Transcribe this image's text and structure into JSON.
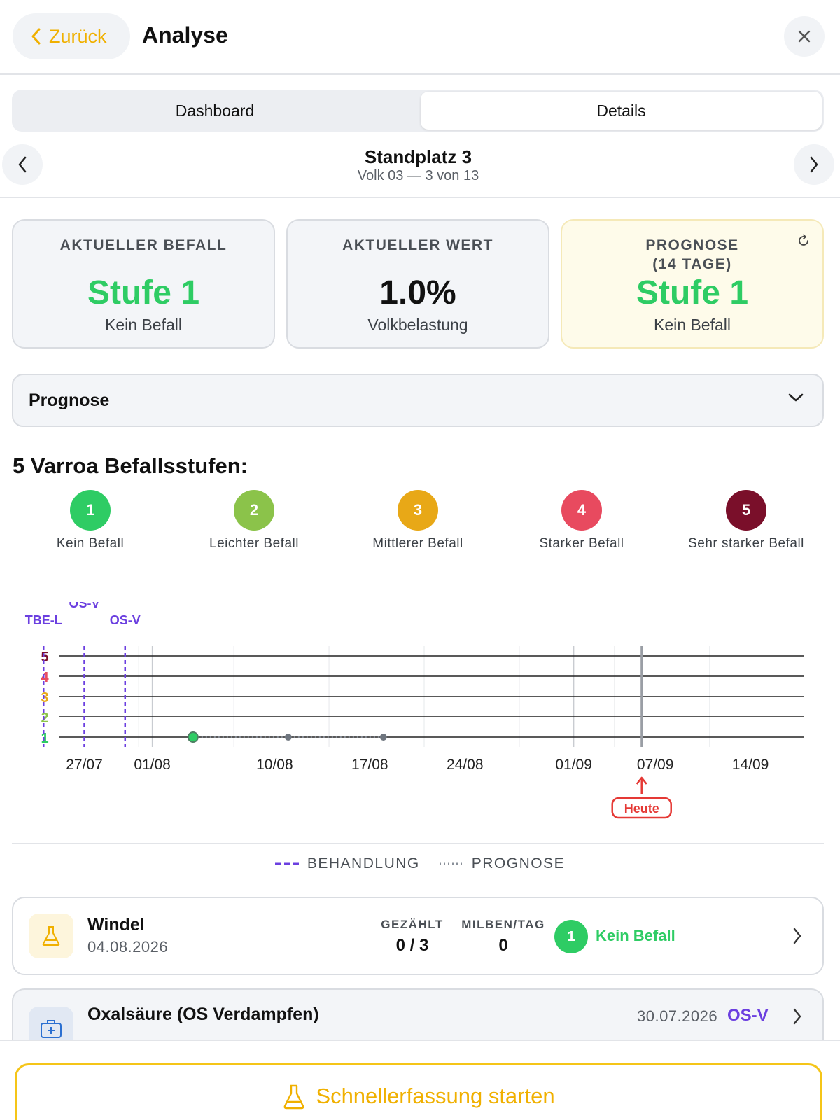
{
  "header": {
    "back_label": "Zurück",
    "title": "Analyse",
    "close_icon": "close-icon",
    "accent_color": "#f0b000"
  },
  "tabs": [
    {
      "label": "Dashboard",
      "selected": false
    },
    {
      "label": "Details",
      "selected": true
    }
  ],
  "location": {
    "title": "Standplatz 3",
    "subtitle": "Volk 03 — 3 von 13"
  },
  "cards": [
    {
      "label": "AKTUELLER BEFALL",
      "value": "Stufe 1",
      "sub": "Kein Befall"
    },
    {
      "label": "AKTUELLER WERT",
      "value": "1.0%",
      "sub": "Volkbelastung"
    },
    {
      "label_line1": "PROGNOSE",
      "label_line2": "(14 TAGE)",
      "value": "Stufe 1",
      "sub": "Kein Befall"
    }
  ],
  "prognose_dropdown": {
    "label": "Prognose"
  },
  "levels": {
    "title": "5 Varroa Befallsstufen:",
    "items": [
      {
        "number": "1",
        "label": "Kein Befall",
        "color": "#2ecc64"
      },
      {
        "number": "2",
        "label": "Leichter Befall",
        "color": "#8bc34a"
      },
      {
        "number": "3",
        "label": "Mittlerer Befall",
        "color": "#e8a817"
      },
      {
        "number": "4",
        "label": "Starker Befall",
        "color": "#e84a5f"
      },
      {
        "number": "5",
        "label": "Sehr starker Befall",
        "color": "#7a0f2a"
      }
    ]
  },
  "chart_data": {
    "type": "line",
    "x_ticks": [
      "27/07",
      "01/08",
      "10/08",
      "17/08",
      "24/08",
      "01/09",
      "07/09",
      "14/09"
    ],
    "y_ticks": [
      "1",
      "2",
      "3",
      "4",
      "5"
    ],
    "y_tick_colors": [
      "#2ecc64",
      "#8bc34a",
      "#e8a817",
      "#e84a5f",
      "#7a0f2a"
    ],
    "ylim": [
      1,
      5
    ],
    "treatments": [
      {
        "label": "TBE-L",
        "date": "24/07"
      },
      {
        "label": "OS-V",
        "date": "27/07"
      },
      {
        "label": "OS-V",
        "date": "30/07"
      }
    ],
    "treatment_color": "#6b3fe0",
    "series": [
      {
        "x": [
          "04/08"
        ],
        "y": [
          1
        ]
      }
    ],
    "forecast": [
      {
        "x": [
          "04/08",
          "11/08",
          "18/08"
        ],
        "y": [
          1,
          1,
          1
        ]
      }
    ],
    "today": {
      "date": "06/09",
      "label": "Heute",
      "color": "#e53935"
    }
  },
  "legend": {
    "treatment": "BEHANDLUNG",
    "forecast": "PROGNOSE"
  },
  "entries": [
    {
      "title": "Windel",
      "date": "04.08.2026",
      "counted_label": "GEZÄHLT",
      "counted_value": "0 / 3",
      "mites_label": "MILBEN/TAG",
      "mites_value": "0",
      "level": "1",
      "level_label": "Kein Befall",
      "icon": "flask-icon"
    },
    {
      "title": "Oxalsäure (OS Verdampfen)",
      "date": "30.07.2026",
      "tag": "OS-V",
      "icon": "medkit-icon"
    }
  ],
  "quick_action": {
    "label": "Schnellerfassung starten",
    "icon": "flask-icon"
  }
}
